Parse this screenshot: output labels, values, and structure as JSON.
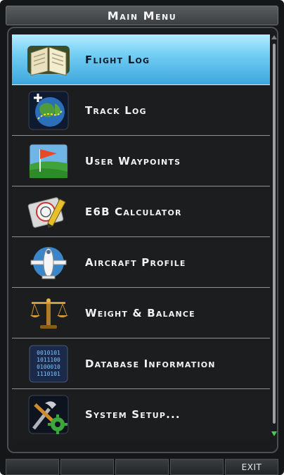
{
  "title": "Main Menu",
  "menu": {
    "items": [
      {
        "label": "Flight Log",
        "icon": "logbook-icon",
        "selected": true
      },
      {
        "label": "Track Log",
        "icon": "globe-track-icon"
      },
      {
        "label": "User Waypoints",
        "icon": "waypoint-flag-icon"
      },
      {
        "label": "E6B Calculator",
        "icon": "e6b-calculator-icon"
      },
      {
        "label": "Aircraft Profile",
        "icon": "aircraft-icon"
      },
      {
        "label": "Weight & Balance",
        "icon": "balance-scale-icon"
      },
      {
        "label": "Database Information",
        "icon": "database-icon"
      },
      {
        "label": "System Setup...",
        "icon": "tools-gear-icon"
      }
    ]
  },
  "softkeys": [
    "",
    "",
    "",
    "",
    "EXIT"
  ],
  "colors": {
    "selected_highlight": "#72cef3",
    "background": "#1a1b1c",
    "scroll_arrow": "#3fd14a"
  }
}
